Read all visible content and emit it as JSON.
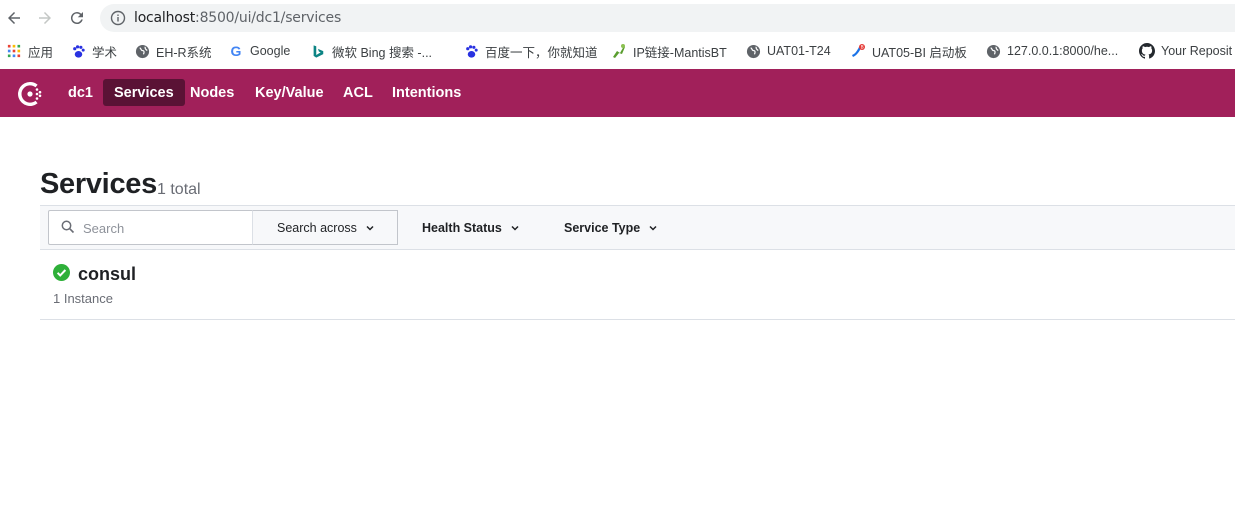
{
  "browser": {
    "url_host": "localhost",
    "url_path": ":8500/ui/dc1/services",
    "bookmarks": [
      {
        "label": "应用",
        "icon": "apps-grid-icon"
      },
      {
        "label": "学术",
        "icon": "baidu-paw-icon"
      },
      {
        "label": "EH-R系统",
        "icon": "globe-icon"
      },
      {
        "label": "Google",
        "icon": "google-icon"
      },
      {
        "label": "微软 Bing 搜索 -...",
        "icon": "bing-icon"
      },
      {
        "label": "百度一下，你就知道",
        "icon": "baidu-paw-icon"
      },
      {
        "label": "IP链接-MantisBT",
        "icon": "mantis-icon"
      },
      {
        "label": "UAT01-T24",
        "icon": "globe-icon"
      },
      {
        "label": "UAT05-BI 启动板",
        "icon": "sap-icon"
      },
      {
        "label": "127.0.0.1:8000/he...",
        "icon": "globe-icon"
      },
      {
        "label": "Your Reposit",
        "icon": "github-icon"
      }
    ]
  },
  "nav": {
    "datacenter": "dc1",
    "items": [
      {
        "label": "Services",
        "active": true
      },
      {
        "label": "Nodes"
      },
      {
        "label": "Key/Value"
      },
      {
        "label": "ACL"
      },
      {
        "label": "Intentions"
      }
    ],
    "accent_color": "#a1205a",
    "active_color": "#5a1235"
  },
  "page": {
    "title": "Services",
    "count": "1 total"
  },
  "filters": {
    "search_placeholder": "Search",
    "search_value": "",
    "search_across": "Search across",
    "health_status": "Health Status",
    "service_type": "Service Type"
  },
  "services": [
    {
      "name": "consul",
      "instances": "1 Instance",
      "status": "passing",
      "status_color": "#2eb039"
    }
  ]
}
